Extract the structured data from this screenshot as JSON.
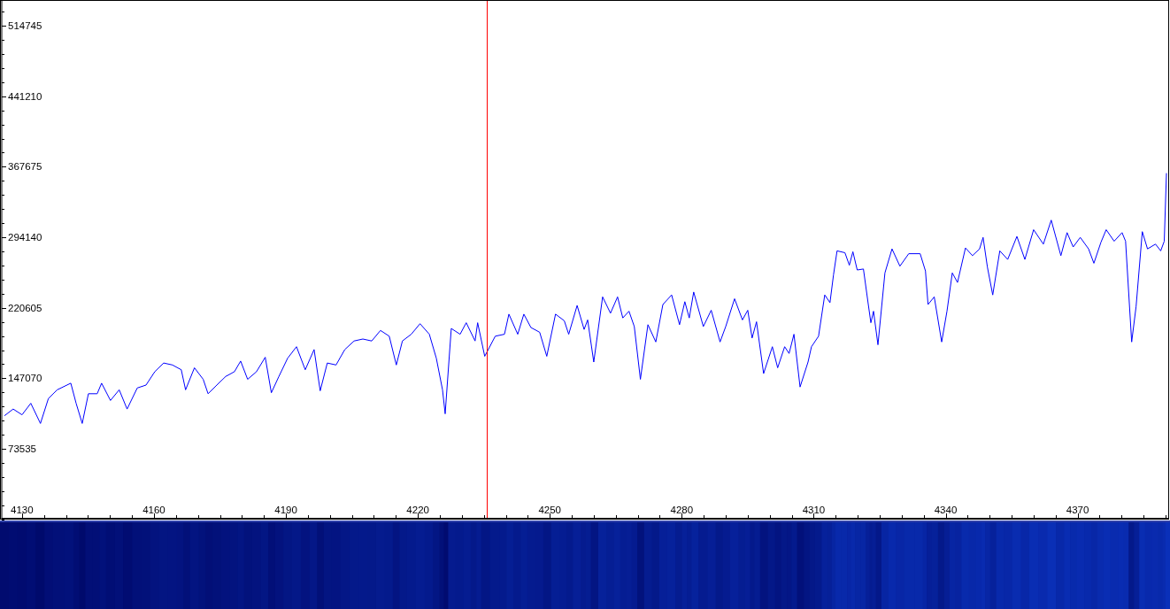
{
  "spectrum": {
    "chart_data": {
      "type": "line",
      "x": [
        4126.0,
        4128.0,
        4130.0,
        4132.0,
        4134.2,
        4136.0,
        4138.0,
        4141.1,
        4142.3,
        4143.7,
        4145.1,
        4147.1,
        4148.1,
        4150.1,
        4152.1,
        4153.9,
        4156.2,
        4158.2,
        4160.2,
        4162.2,
        4164.2,
        4166.2,
        4167.2,
        4169.2,
        4171.2,
        4172.3,
        4174.3,
        4176.3,
        4178.3,
        4179.7,
        4181.3,
        4183.3,
        4185.3,
        4186.7,
        4188.4,
        4190.4,
        4192.4,
        4194.4,
        4196.4,
        4197.8,
        4199.4,
        4201.4,
        4203.4,
        4205.5,
        4207.5,
        4209.5,
        4211.5,
        4213.5,
        4215.1,
        4216.5,
        4218.5,
        4220.5,
        4222.6,
        4224.2,
        4225.6,
        4226.2,
        4227.6,
        4229.6,
        4231.0,
        4233.0,
        4233.6,
        4235.2,
        4237.6,
        4239.7,
        4240.7,
        4242.7,
        4244.1,
        4245.7,
        4247.7,
        4249.3,
        4251.3,
        4253.3,
        4254.3,
        4256.2,
        4257.8,
        4258.6,
        4260.0,
        4262.0,
        4263.8,
        4265.4,
        4266.6,
        4268.0,
        4269.2,
        4270.6,
        4272.3,
        4274.1,
        4275.7,
        4277.7,
        4279.5,
        4280.7,
        4281.7,
        4282.7,
        4284.9,
        4286.7,
        4288.7,
        4290.0,
        4292.0,
        4293.8,
        4295.0,
        4296.0,
        4297.0,
        4298.6,
        4300.6,
        4301.8,
        4303.4,
        4304.4,
        4305.5,
        4306.9,
        4308.7,
        4309.5,
        4311.1,
        4312.5,
        4313.7,
        4314.5,
        4315.3,
        4317.1,
        4318.1,
        4318.9,
        4319.9,
        4321.3,
        4322.4,
        4323.0,
        4323.6,
        4324.6,
        4326.2,
        4327.8,
        4329.6,
        4331.6,
        4334.2,
        4335.4,
        4336.0,
        4337.4,
        4339.1,
        4340.3,
        4341.5,
        4342.7,
        4344.5,
        4346.1,
        4347.7,
        4348.5,
        4349.5,
        4350.7,
        4352.3,
        4354.1,
        4356.2,
        4358.0,
        4360.0,
        4362.2,
        4364.0,
        4366.2,
        4367.6,
        4369.0,
        4370.6,
        4372.5,
        4373.7,
        4375.3,
        4376.5,
        4378.3,
        4380.1,
        4380.9,
        4382.3,
        4383.3,
        4384.7,
        4385.9,
        4387.7,
        4388.9,
        4389.7,
        4390.2
      ],
      "series": [
        {
          "color": "#0000ff",
          "values": [
            108000,
            115000,
            109000,
            121000,
            100000,
            126000,
            135000,
            142000,
            121000,
            100000,
            131000,
            131000,
            142000,
            124000,
            135000,
            115000,
            137000,
            140000,
            154000,
            163000,
            161000,
            156000,
            135000,
            158000,
            146000,
            131000,
            140000,
            149000,
            154000,
            165000,
            146000,
            154000,
            169000,
            132000,
            149000,
            168000,
            180000,
            156000,
            177000,
            134000,
            163000,
            161000,
            177000,
            186000,
            188000,
            186000,
            197000,
            191000,
            161000,
            186000,
            193000,
            204000,
            193000,
            168000,
            135000,
            110000,
            199000,
            193000,
            205000,
            186000,
            205000,
            170000,
            191000,
            193000,
            214000,
            193000,
            214000,
            200000,
            195000,
            170000,
            214000,
            207000,
            193000,
            223000,
            198000,
            208000,
            164000,
            232000,
            215000,
            232000,
            210000,
            217000,
            201000,
            146000,
            203000,
            185000,
            224000,
            234000,
            203000,
            227000,
            210000,
            237000,
            201000,
            218000,
            185000,
            201000,
            230000,
            208000,
            218000,
            189000,
            206000,
            152000,
            180000,
            158000,
            180000,
            173000,
            193000,
            138000,
            164000,
            180000,
            191000,
            234000,
            226000,
            255000,
            280000,
            278000,
            265000,
            279000,
            260000,
            261000,
            224000,
            205000,
            217000,
            182000,
            257000,
            282000,
            264000,
            277000,
            277000,
            259000,
            224000,
            232000,
            185000,
            217000,
            257000,
            247000,
            283000,
            275000,
            282000,
            294000,
            263000,
            234000,
            280000,
            271000,
            295000,
            271000,
            302000,
            287000,
            312000,
            275000,
            299000,
            284000,
            294000,
            282000,
            267000,
            289000,
            302000,
            290000,
            299000,
            290000,
            185000,
            222000,
            300000,
            282000,
            287000,
            280000,
            290000,
            361000
          ]
        }
      ],
      "xlim": [
        4125.4,
        4390.4
      ],
      "ylim": [
        0,
        539700
      ],
      "xticks": [
        4130,
        4160,
        4190,
        4220,
        4250,
        4280,
        4310,
        4340,
        4370
      ],
      "yticks": [
        73535,
        147070,
        220605,
        294140,
        367675,
        441210,
        514745
      ],
      "ref_lines": [
        {
          "axis": "x",
          "value": 4235.6,
          "color": "#ff0000"
        }
      ]
    }
  }
}
